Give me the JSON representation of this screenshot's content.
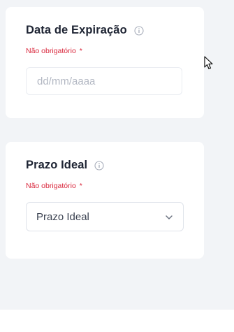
{
  "expiration": {
    "title": "Data de Expiração",
    "hint": "Não obrigatório",
    "required_mark": "*",
    "date_placeholder": "dd/mm/aaaa",
    "date_value": ""
  },
  "deadline": {
    "title": "Prazo Ideal",
    "hint": "Não obrigatório",
    "required_mark": "*",
    "selected": "Prazo Ideal"
  },
  "icons": {
    "info": "info-circle-icon",
    "dropdown": "chevron-down-icon",
    "cursor": "mouse-pointer-icon"
  },
  "colors": {
    "background": "#f2f4f7",
    "card": "#ffffff",
    "title": "#1e2433",
    "hint": "#d9263b",
    "placeholder": "#b3b8c3",
    "border": "#dfe3ea"
  }
}
